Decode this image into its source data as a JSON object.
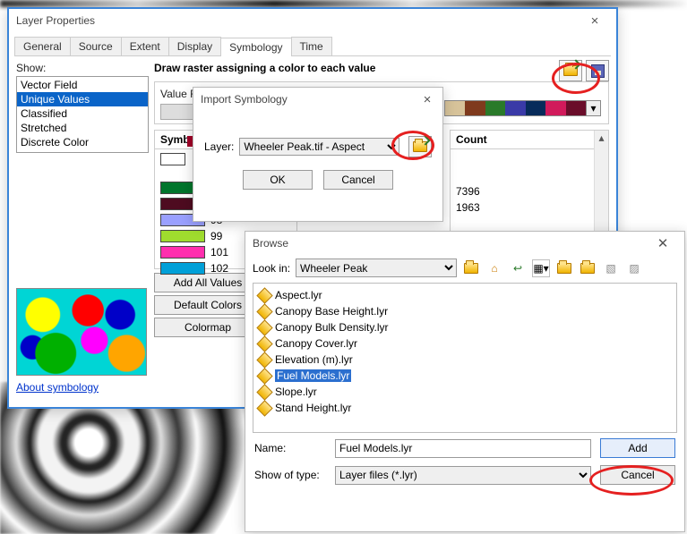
{
  "layer_props": {
    "title": "Layer Properties",
    "tabs": [
      "General",
      "Source",
      "Extent",
      "Display",
      "Symbology",
      "Time"
    ],
    "active_tab": "Symbology",
    "show_label": "Show:",
    "show_items": [
      "Vector Field",
      "Unique Values",
      "Classified",
      "Stretched",
      "Discrete Color"
    ],
    "show_selected": "Unique Values",
    "heading": "Draw raster assigning a color to each value",
    "value_field_label": "Value Fi",
    "symbol_header": "Symbol",
    "count_header": "Count",
    "rows": [
      {
        "color": "#ffffff",
        "label": "",
        "count": ""
      },
      {
        "color": "#a10028",
        "label": "",
        "count": ""
      },
      {
        "color": "#00752c",
        "label": "",
        "count": "7396"
      },
      {
        "color": "#4e0b20",
        "label": "",
        "count": "1963"
      },
      {
        "color": "#9aa0ff",
        "label": "98",
        "count": ""
      },
      {
        "color": "#9fdc2e",
        "label": "99",
        "count": ""
      },
      {
        "color": "#ff2fae",
        "label": "101",
        "count": ""
      },
      {
        "color": "#00a0d8",
        "label": "102",
        "count": ""
      }
    ],
    "buttons": {
      "add_all": "Add All Values",
      "default_colors": "Default Colors",
      "colormap": "Colormap"
    },
    "about_link": "About symbology",
    "ramp": [
      "#d7c39a",
      "#7f3a1d",
      "#2a7a2a",
      "#3a3aa7",
      "#072b5a",
      "#d11a5b",
      "#6a0d2a"
    ]
  },
  "import_dlg": {
    "title": "Import Symbology",
    "layer_label": "Layer:",
    "layer_value": "Wheeler Peak.tif - Aspect",
    "ok": "OK",
    "cancel": "Cancel"
  },
  "browse_dlg": {
    "title": "Browse",
    "lookin_label": "Look in:",
    "lookin_value": "Wheeler Peak",
    "files": [
      "Aspect.lyr",
      "Canopy Base Height.lyr",
      "Canopy Bulk Density.lyr",
      "Canopy Cover.lyr",
      "Elevation (m).lyr",
      "Fuel Models.lyr",
      "Slope.lyr",
      "Stand Height.lyr"
    ],
    "selected_file": "Fuel Models.lyr",
    "name_label": "Name:",
    "name_value": "Fuel Models.lyr",
    "type_label": "Show of type:",
    "type_value": "Layer files (*.lyr)",
    "add": "Add",
    "cancel": "Cancel"
  }
}
